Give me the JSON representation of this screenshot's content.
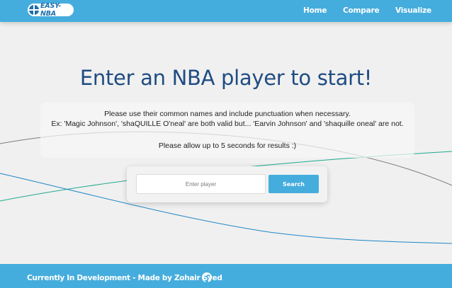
{
  "header": {
    "logo_text": "EASY-NBA",
    "nav": {
      "home": "Home",
      "compare": "Compare",
      "visualize": "Visualize"
    }
  },
  "main": {
    "title": "Enter an NBA player to start!",
    "notice": {
      "line1": "Please use their common names and include punctuation when necessary.",
      "line2": "Ex: 'Magic Johnson', 'shaQUILLE O'neal' are both valid but... 'Earvin Johnson' and 'shaquille oneal' are not.",
      "line3": "Please allow up to 5 seconds for results :)"
    },
    "search": {
      "placeholder": "Enter player",
      "value": "",
      "button_label": "Search"
    }
  },
  "footer": {
    "text": "Currently In Development - Made by Zohair Syed",
    "icon": "github-icon"
  },
  "colors": {
    "brand_blue": "#45addd",
    "title_blue": "#1f4c82",
    "background": "#f0f0f0",
    "line_gray": "#7d7d7d",
    "line_teal": "#1ea98c",
    "line_blue": "#1b85c5"
  }
}
